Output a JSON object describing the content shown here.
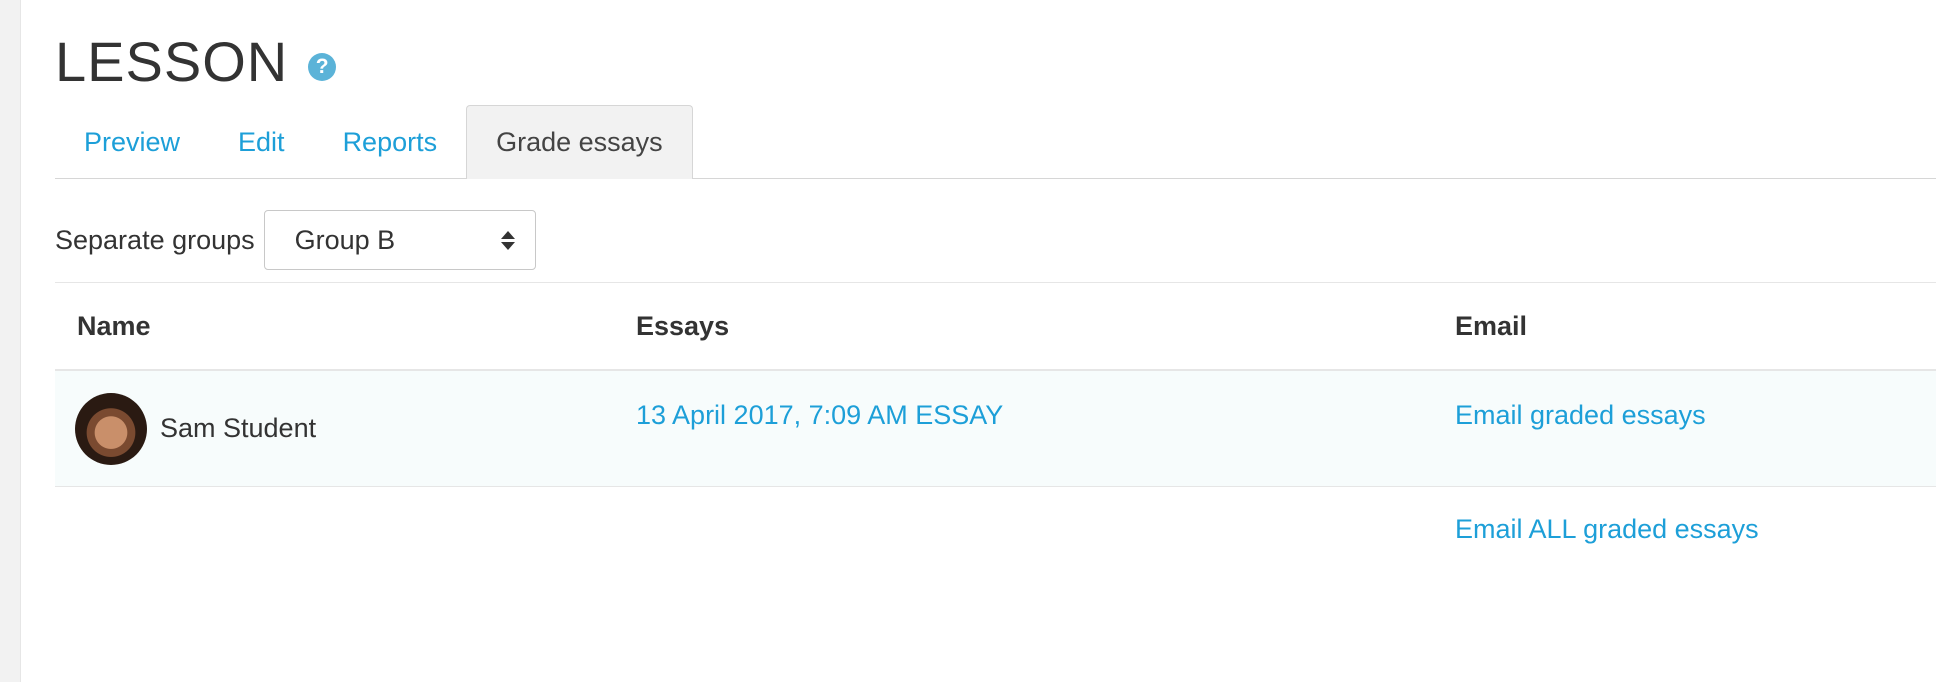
{
  "page": {
    "title": "LESSON"
  },
  "tabs": [
    {
      "label": "Preview"
    },
    {
      "label": "Edit"
    },
    {
      "label": "Reports"
    },
    {
      "label": "Grade essays",
      "active": true
    }
  ],
  "groups": {
    "label": "Separate groups",
    "selected": "Group B"
  },
  "table": {
    "headers": {
      "name": "Name",
      "essays": "Essays",
      "email": "Email"
    },
    "rows": [
      {
        "name": "Sam Student",
        "essay_link": "13 April 2017, 7:09 AM ESSAY",
        "email_link": "Email graded essays"
      }
    ],
    "footer_email_link": "Email ALL graded essays"
  },
  "colors": {
    "link": "#1d9fd8",
    "active_tab_bg": "#f2f2f2",
    "help_icon": "#5bb3d8"
  },
  "icons": {
    "help": "help-circle-icon",
    "select": "select-arrows-icon"
  }
}
